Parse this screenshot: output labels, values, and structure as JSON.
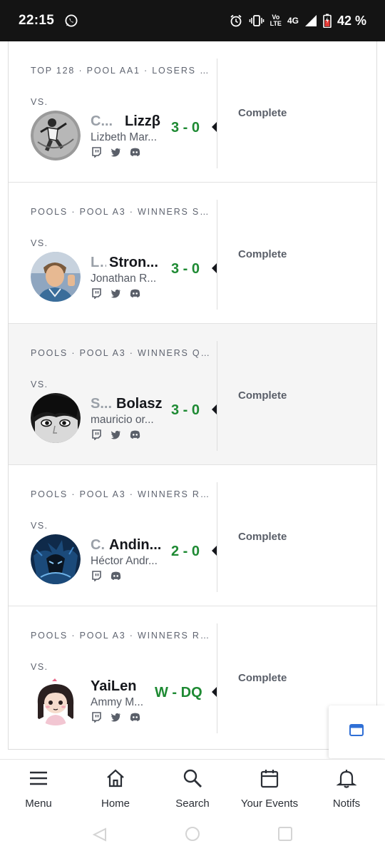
{
  "status_bar": {
    "time": "22:15",
    "volte_top": "Vo",
    "volte_bottom": "LTE",
    "network": "4G",
    "battery_percent": "42 %"
  },
  "sets": [
    {
      "phase": "TOP 128 · POOL AA1 · LOSERS R...",
      "vs_label": "VS.",
      "prefix": "C...",
      "gamer_tag": "Lizzβ",
      "real_name": "Lizbeth Mar...",
      "score": "3 - 0",
      "state": "Complete",
      "socials": [
        "twitch-icon",
        "twitter-icon",
        "discord-icon"
      ],
      "highlighted": false
    },
    {
      "phase": "POOLS · POOL A3 · WINNERS SE...",
      "vs_label": "VS.",
      "prefix": "L..",
      "gamer_tag": "Stron...",
      "real_name": "Jonathan R...",
      "score": "3 - 0",
      "state": "Complete",
      "socials": [
        "twitch-icon",
        "twitter-icon",
        "discord-icon"
      ],
      "highlighted": false
    },
    {
      "phase": "POOLS · POOL A3 · WINNERS QU...",
      "vs_label": "VS.",
      "prefix": "S...",
      "gamer_tag": "Bolasz",
      "real_name": "mauricio or...",
      "score": "3 - 0",
      "state": "Complete",
      "socials": [
        "twitch-icon",
        "twitter-icon",
        "discord-icon"
      ],
      "highlighted": true
    },
    {
      "phase": "POOLS · POOL A3 · WINNERS RO...",
      "vs_label": "VS.",
      "prefix": "C.",
      "gamer_tag": "Andin...",
      "real_name": "Héctor Andr...",
      "score": "2 - 0",
      "state": "Complete",
      "socials": [
        "twitch-icon",
        "discord-icon"
      ],
      "highlighted": false
    },
    {
      "phase": "POOLS · POOL A3 · WINNERS RO...",
      "vs_label": "VS.",
      "prefix": "",
      "gamer_tag": "YaiLen",
      "real_name": "Ammy M...",
      "score": "W - DQ",
      "state": "Complete",
      "socials": [
        "twitch-icon",
        "twitter-icon",
        "discord-icon"
      ],
      "highlighted": false
    }
  ],
  "bottom_nav": [
    {
      "label": "Menu",
      "icon": "menu-icon"
    },
    {
      "label": "Home",
      "icon": "home-icon"
    },
    {
      "label": "Search",
      "icon": "search-icon"
    },
    {
      "label": "Your Events",
      "icon": "calendar-icon"
    },
    {
      "label": "Notifs",
      "icon": "bell-icon"
    }
  ],
  "colors": {
    "score_green": "#1e8a33",
    "status_bar_bg": "#141414",
    "fab_icon_blue": "#2f6fd6"
  }
}
